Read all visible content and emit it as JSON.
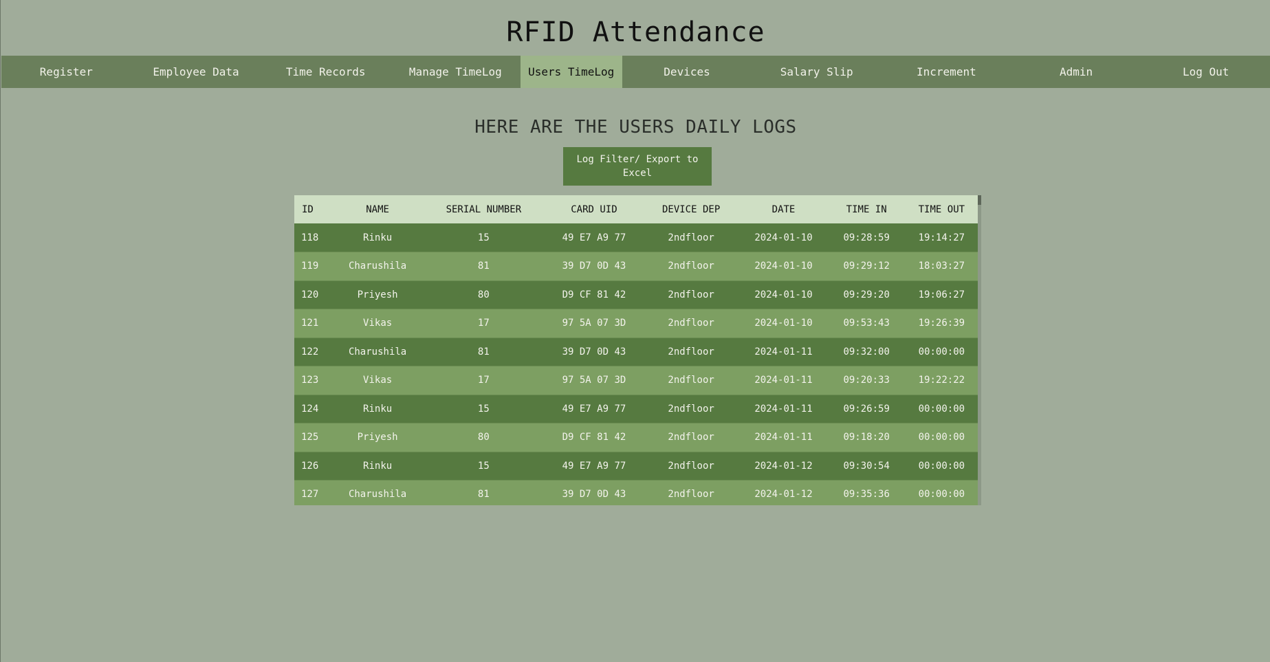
{
  "app_title": "RFID Attendance",
  "nav": {
    "items": [
      {
        "label": "Register",
        "active": false
      },
      {
        "label": "Employee Data",
        "active": false
      },
      {
        "label": "Time Records",
        "active": false
      },
      {
        "label": "Manage TimeLog",
        "active": false
      },
      {
        "label": "Users TimeLog",
        "active": true
      },
      {
        "label": "Devices",
        "active": false
      },
      {
        "label": "Salary Slip",
        "active": false
      },
      {
        "label": "Increment",
        "active": false
      },
      {
        "label": "Admin",
        "active": false
      },
      {
        "label": "Log Out",
        "active": false
      }
    ]
  },
  "main": {
    "heading": "HERE ARE THE USERS DAILY LOGS",
    "filter_button": "Log Filter/ Export to Excel"
  },
  "table": {
    "columns": [
      "ID",
      "NAME",
      "SERIAL NUMBER",
      "CARD UID",
      "DEVICE DEP",
      "DATE",
      "TIME IN",
      "TIME OUT"
    ],
    "rows": [
      [
        "118",
        "Rinku",
        "15",
        "49 E7 A9 77",
        "2ndfloor",
        "2024-01-10",
        "09:28:59",
        "19:14:27"
      ],
      [
        "119",
        "Charushila",
        "81",
        "39 D7 0D 43",
        "2ndfloor",
        "2024-01-10",
        "09:29:12",
        "18:03:27"
      ],
      [
        "120",
        "Priyesh",
        "80",
        "D9 CF 81 42",
        "2ndfloor",
        "2024-01-10",
        "09:29:20",
        "19:06:27"
      ],
      [
        "121",
        "Vikas",
        "17",
        "97 5A 07 3D",
        "2ndfloor",
        "2024-01-10",
        "09:53:43",
        "19:26:39"
      ],
      [
        "122",
        "Charushila",
        "81",
        "39 D7 0D 43",
        "2ndfloor",
        "2024-01-11",
        "09:32:00",
        "00:00:00"
      ],
      [
        "123",
        "Vikas",
        "17",
        "97 5A 07 3D",
        "2ndfloor",
        "2024-01-11",
        "09:20:33",
        "19:22:22"
      ],
      [
        "124",
        "Rinku",
        "15",
        "49 E7 A9 77",
        "2ndfloor",
        "2024-01-11",
        "09:26:59",
        "00:00:00"
      ],
      [
        "125",
        "Priyesh",
        "80",
        "D9 CF 81 42",
        "2ndfloor",
        "2024-01-11",
        "09:18:20",
        "00:00:00"
      ],
      [
        "126",
        "Rinku",
        "15",
        "49 E7 A9 77",
        "2ndfloor",
        "2024-01-12",
        "09:30:54",
        "00:00:00"
      ],
      [
        "127",
        "Charushila",
        "81",
        "39 D7 0D 43",
        "2ndfloor",
        "2024-01-12",
        "09:35:36",
        "00:00:00"
      ]
    ]
  },
  "colors": {
    "page_bg": "#a0ac9a",
    "nav_bg": "#6a7f5b",
    "nav_active_bg": "#9db58a",
    "button_bg": "#567a40",
    "table_header_bg": "#cfdfc4",
    "row_dark": "#567a40",
    "row_light": "#7d9f62"
  }
}
